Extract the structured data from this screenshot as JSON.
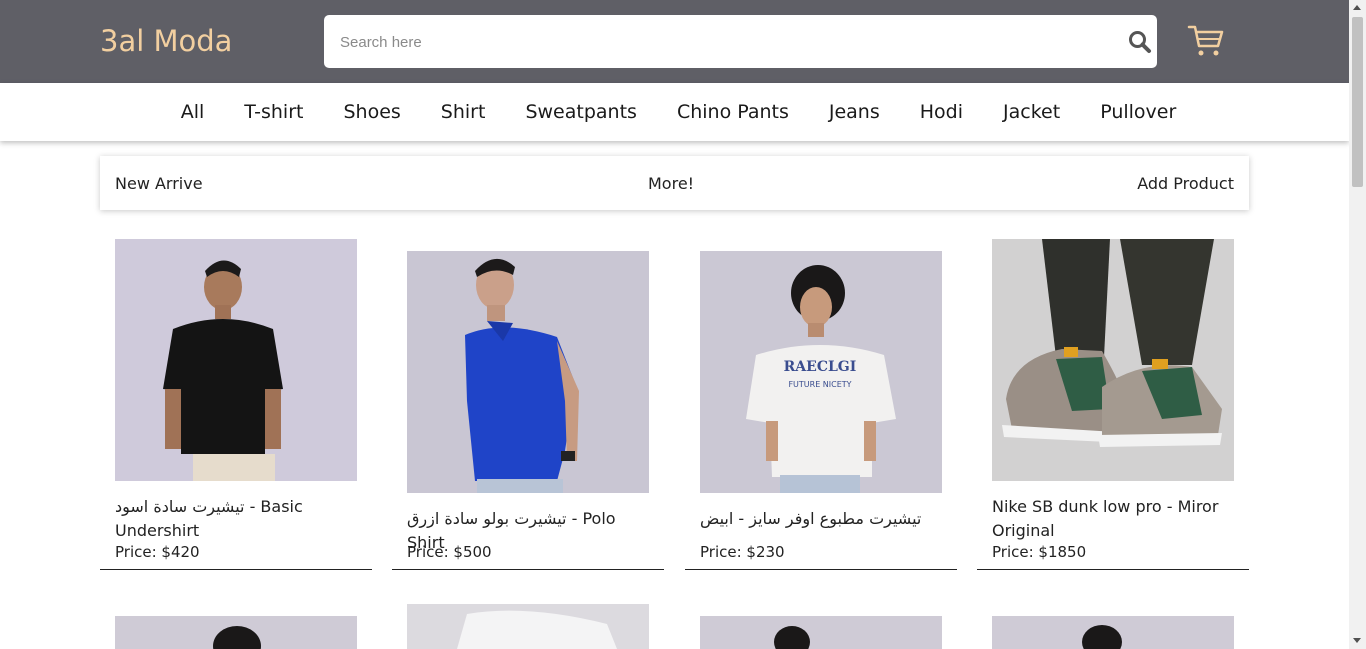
{
  "header": {
    "brand": "3al Moda",
    "search_placeholder": "Search here",
    "search_icon": "search-icon",
    "cart_icon": "cart-icon",
    "background": "#5f5f66",
    "brand_color": "#f2cfa0"
  },
  "nav": {
    "items": [
      "All",
      "T-shirt",
      "Shoes",
      "Shirt",
      "Sweatpants",
      "Chino Pants",
      "Jeans",
      "Hodi",
      "Jacket",
      "Pullover"
    ]
  },
  "subbar": {
    "left": "New Arrive",
    "center": "More!",
    "right": "Add Product"
  },
  "products": [
    {
      "title": "تيشيرت سادة اسود - Basic Undershirt",
      "price": "Price: $420"
    },
    {
      "title": "تيشيرت بولو سادة ازرق - Polo Shirt",
      "price": "Price: $500"
    },
    {
      "title": "تيشيرت مطبوع اوفر سايز - ابيض",
      "price": "Price: $230"
    },
    {
      "title": "Nike SB dunk low pro - Miror Original",
      "price": "Price: $1850"
    }
  ]
}
